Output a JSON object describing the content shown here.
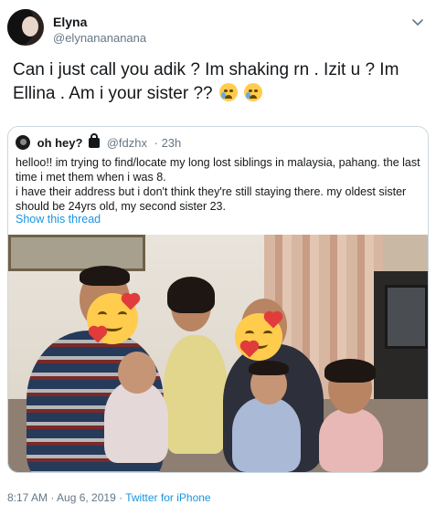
{
  "tweet": {
    "author_name": "Elyna",
    "author_handle": "@elynanananana",
    "text": "Can i just call you adik ? Im shaking rn . Izit u ? Im Ellina . Am i your sister ??",
    "emoji": [
      "loudly-crying-face",
      "crying-face"
    ],
    "timestamp": "8:17 AM · Aug 6, 2019",
    "separator": " · ",
    "source": "Twitter for iPhone"
  },
  "quoted": {
    "author_name": "oh hey?",
    "author_handle": "@fdzhx",
    "age": "· 23h",
    "lines": [
      "helloo!! im trying to find/locate my long lost siblings in malaysia, pahang. the last time i met them when i was 8.",
      "i have their address but i don't think they're still staying there. my oldest sister should be 24yrs old, my second sister 23."
    ],
    "show_thread": "Show this thread",
    "photo_icon": "family-photo"
  },
  "colors": {
    "link": "#1b95e0",
    "secondary_text": "#657786",
    "border": "#ccd6dd"
  }
}
